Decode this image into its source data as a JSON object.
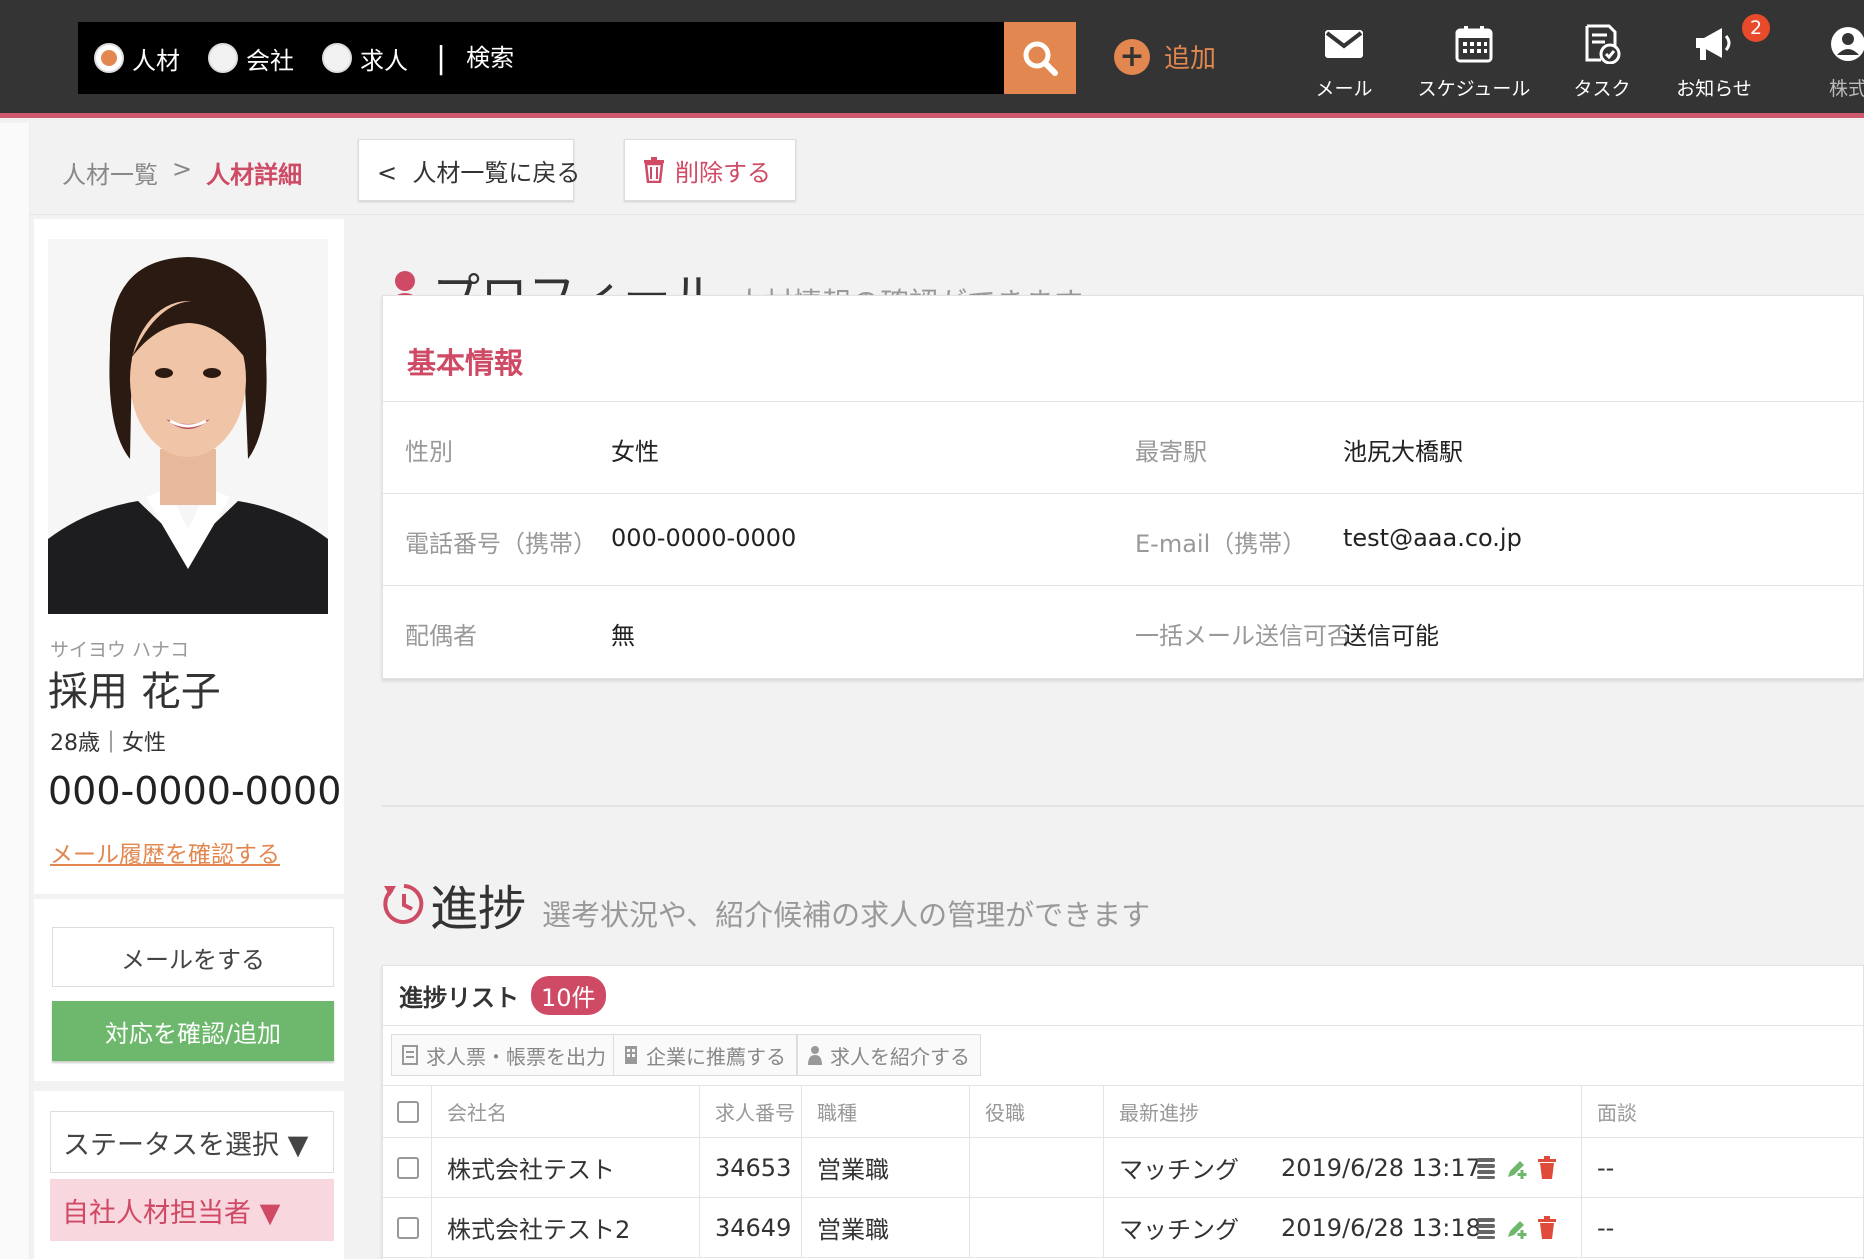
{
  "header": {
    "search_types": [
      {
        "label": "人材",
        "selected": true
      },
      {
        "label": "会社",
        "selected": false
      },
      {
        "label": "求人",
        "selected": false
      }
    ],
    "search_placeholder": "検索",
    "add_label": "追加",
    "nav": [
      {
        "label": "メール",
        "icon": "mail-icon"
      },
      {
        "label": "スケジュール",
        "icon": "calendar-icon"
      },
      {
        "label": "タスク",
        "icon": "task-icon"
      },
      {
        "label": "お知らせ",
        "icon": "megaphone-icon",
        "badge": "2"
      },
      {
        "label": "株式",
        "icon": "user-icon"
      }
    ],
    "accent_color": "#e2874f",
    "brand_color": "#cf5a6e"
  },
  "breadcrumb": {
    "parent": "人材一覧",
    "separator": ">",
    "current": "人材詳細",
    "back_label": "<  人材一覧に戻る",
    "delete_label": "削除する"
  },
  "profile": {
    "kana": "サイヨウ ハナコ",
    "name": "採用 花子",
    "age_gender": "28歳｜女性",
    "phone": "000-0000-0000",
    "mail_history_link": "メール履歴を確認する",
    "mail_button": "メールをする",
    "confirm_button": "対応を確認/追加",
    "status_select": "ステータスを選択 ▼",
    "owner_select": "自社人材担当者 ▼"
  },
  "profile_section": {
    "title": "プロフィール",
    "subtitle": "人材情報の確認ができます",
    "basic_title": "基本情報",
    "rows": [
      {
        "l1": "性別",
        "v1": "女性",
        "l2": "最寄駅",
        "v2": "池尻大橋駅"
      },
      {
        "l1": "電話番号（携帯）",
        "v1": "000-0000-0000",
        "l2": "E-mail（携帯）",
        "v2": "test@aaa.co.jp"
      },
      {
        "l1": "配偶者",
        "v1": "無",
        "l2": "一括メール送信可否",
        "v2": "送信可能"
      }
    ]
  },
  "progress_section": {
    "title": "進捗",
    "subtitle": "選考状況や、紹介候補の求人の管理ができます",
    "list_title": "進捗リスト",
    "count": "10件",
    "tools": [
      "求人票・帳票を出力",
      "企業に推薦する",
      "求人を紹介する"
    ],
    "columns": [
      "会社名",
      "求人番号",
      "職種",
      "役職",
      "最新進捗",
      "面談"
    ],
    "rows": [
      {
        "company": "株式会社テスト",
        "job_no": "34653",
        "type": "営業職",
        "position": "",
        "status": "マッチング",
        "datetime": "2019/6/28 13:17",
        "extra": "--"
      },
      {
        "company": "株式会社テスト2",
        "job_no": "34649",
        "type": "営業職",
        "position": "",
        "status": "マッチング",
        "datetime": "2019/6/28 13:18",
        "extra": "--"
      }
    ]
  }
}
